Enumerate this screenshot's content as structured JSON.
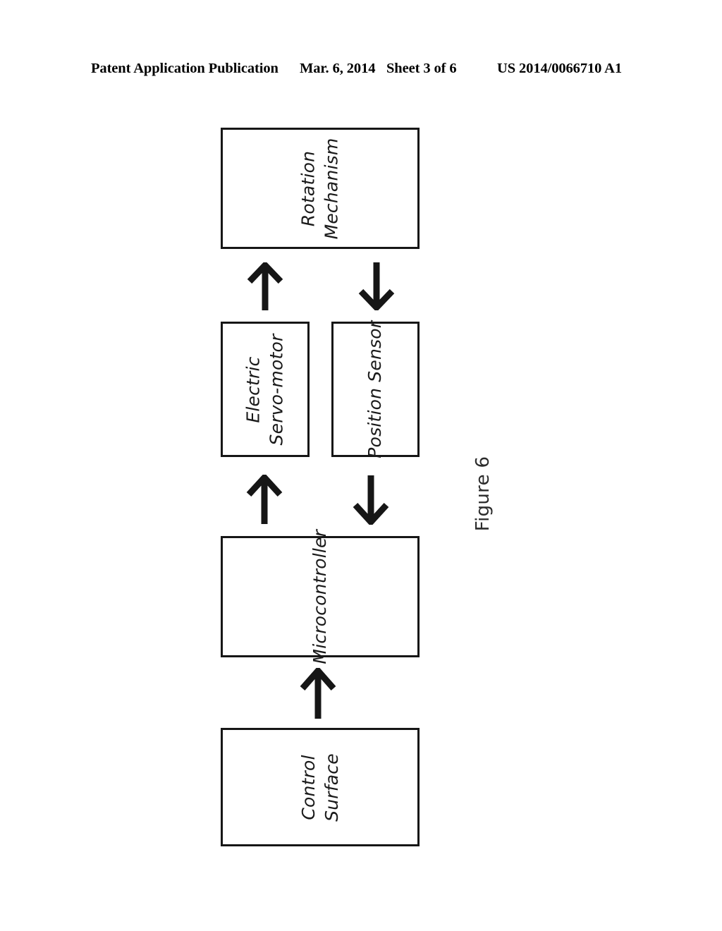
{
  "header": {
    "publication": "Patent Application Publication",
    "date": "Mar. 6, 2014",
    "sheet": "Sheet 3 of 6",
    "document_number": "US 2014/0066710 A1"
  },
  "figure": {
    "caption": "Figure 6",
    "colors": {
      "ink": "#161616",
      "background": "#ffffff"
    }
  },
  "diagram": {
    "type": "block-diagram",
    "nodes": [
      {
        "id": "rotation-mechanism",
        "lines": [
          "Rotation",
          "Mechanism"
        ],
        "text": "Rotation Mechanism"
      },
      {
        "id": "electric-servo-motor",
        "lines": [
          "Electric",
          "Servo-motor"
        ],
        "text": "Electric Servo-motor"
      },
      {
        "id": "position-sensor",
        "lines": [
          "Position Sensor"
        ],
        "text": "Position Sensor"
      },
      {
        "id": "microcontroller",
        "lines": [
          "Microcontroller"
        ],
        "text": "Microcontroller"
      },
      {
        "id": "control-surface",
        "lines": [
          "Control",
          "Surface"
        ],
        "text": "Control Surface"
      }
    ],
    "arrows": [
      {
        "id": "servo-to-rotation",
        "from": "electric-servo-motor",
        "to": "rotation-mechanism",
        "direction": "up",
        "icon": "arrow-up-icon"
      },
      {
        "id": "rotation-to-sensor",
        "from": "rotation-mechanism",
        "to": "position-sensor",
        "direction": "down",
        "icon": "arrow-down-icon"
      },
      {
        "id": "micro-to-servo",
        "from": "microcontroller",
        "to": "electric-servo-motor",
        "direction": "up",
        "icon": "arrow-up-icon"
      },
      {
        "id": "sensor-to-micro",
        "from": "position-sensor",
        "to": "microcontroller",
        "direction": "down",
        "icon": "arrow-down-icon"
      },
      {
        "id": "surface-to-micro",
        "from": "control-surface",
        "to": "microcontroller",
        "direction": "up",
        "icon": "arrow-up-icon"
      }
    ]
  }
}
